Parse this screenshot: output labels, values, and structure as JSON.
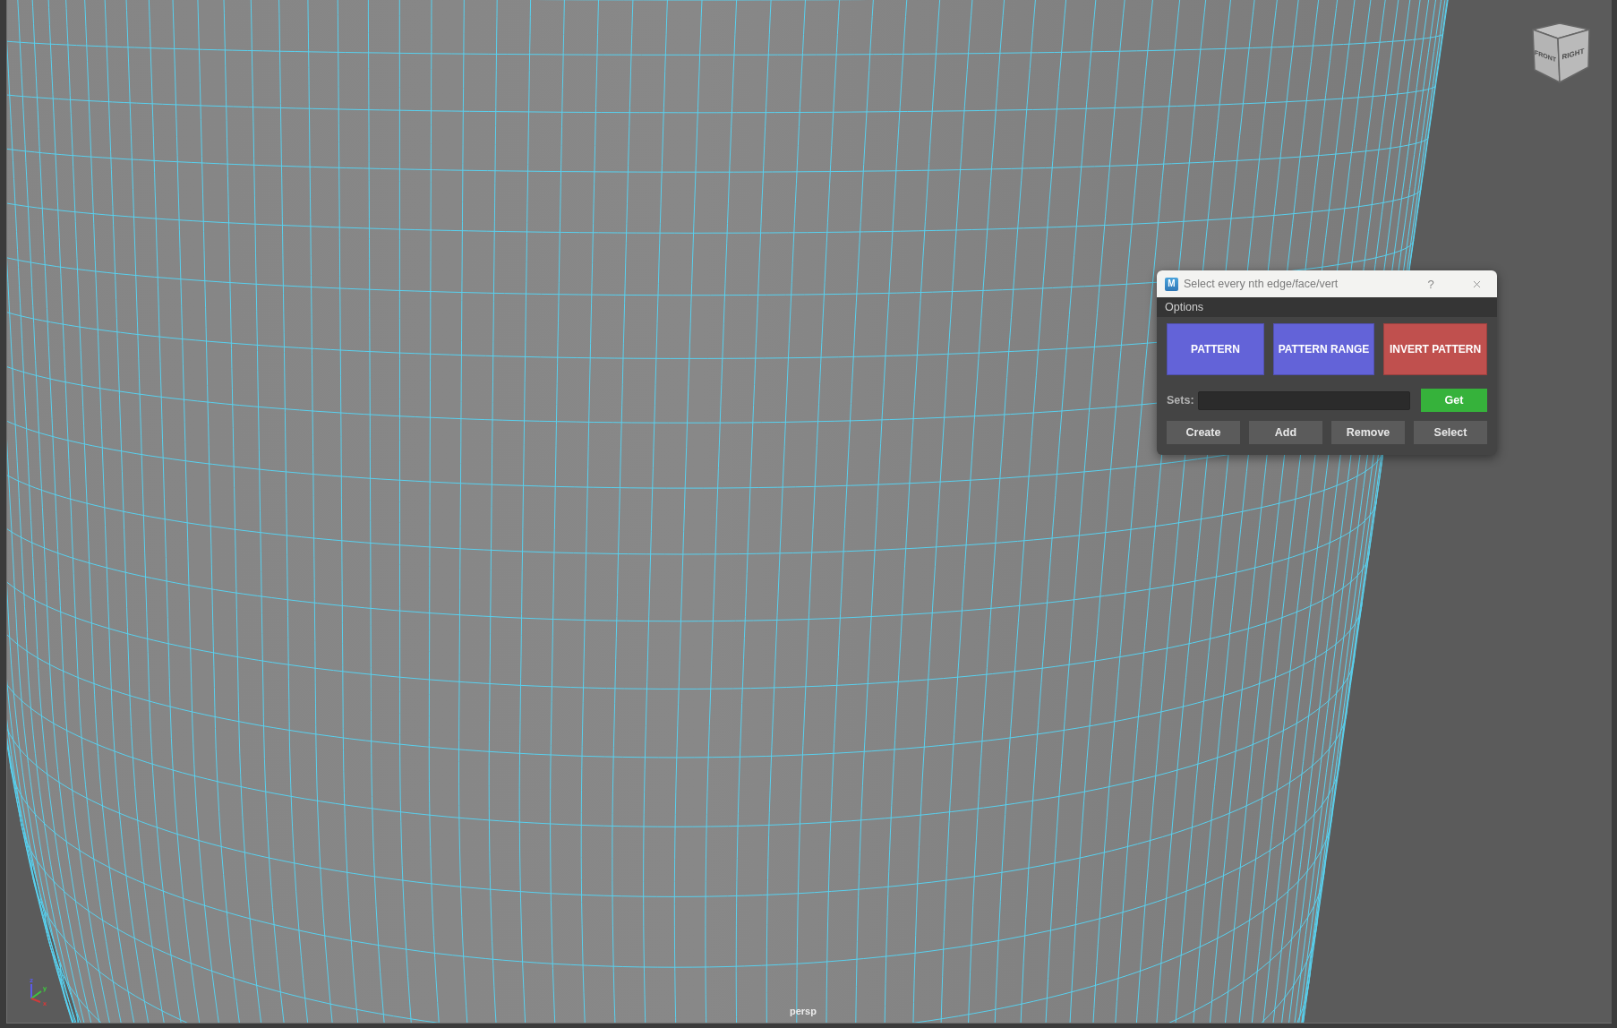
{
  "viewport": {
    "camera": "persp",
    "view_cube": {
      "labels": [
        "FRONT",
        "RIGHT"
      ]
    },
    "axes": [
      {
        "label": "z",
        "color": "#5b5bea"
      },
      {
        "label": "y",
        "color": "#3fc43f"
      },
      {
        "label": "x",
        "color": "#d03a3a"
      }
    ]
  },
  "dialog": {
    "logo": "M",
    "title": "Select every nth edge/face/vert",
    "help": "?",
    "menu": [
      "Options"
    ],
    "pattern_buttons": [
      {
        "label": "PATTERN",
        "color": "#6363d8"
      },
      {
        "label": "PATTERN RANGE",
        "color": "#6363d8"
      },
      {
        "label": "INVERT PATTERN",
        "color": "#c0504e"
      }
    ],
    "sets": {
      "label": "Sets:",
      "get_button": "Get"
    },
    "set_buttons": [
      "Create",
      "Add",
      "Remove",
      "Select"
    ]
  }
}
